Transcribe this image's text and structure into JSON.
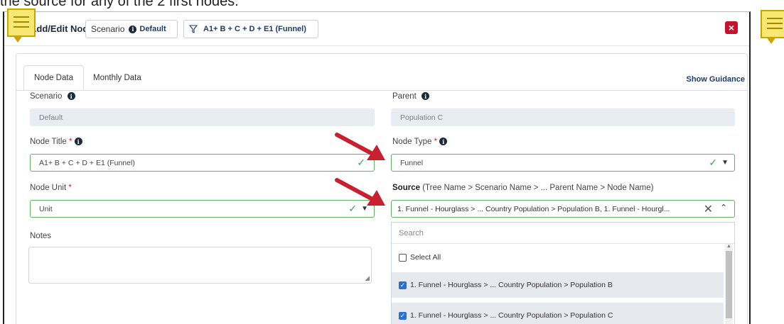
{
  "header": {
    "title": "Add/Edit Node",
    "scenario_label": "Scenario",
    "scenario_value": "Default",
    "node_label": "A1+ B + C + D + E1 (Funnel)"
  },
  "tabs": [
    {
      "label": "Node Data",
      "active": true
    },
    {
      "label": "Monthly Data",
      "active": false
    }
  ],
  "show_guidance": "Show Guidance",
  "form": {
    "scenario": {
      "label": "Scenario",
      "value": "Default"
    },
    "parent": {
      "label": "Parent",
      "value": "Population C"
    },
    "node_title": {
      "label": "Node Title",
      "value": "A1+ B + C + D + E1 (Funnel)"
    },
    "node_type": {
      "label": "Node Type",
      "value": "Funnel"
    },
    "node_unit": {
      "label": "Node Unit",
      "value": "Unit"
    },
    "source": {
      "label": "Source",
      "hint": "(Tree Name > Scenario Name > ... Parent Name > Node Name)",
      "value": "1. Funnel - Hourglass > ... Country Population > Population B, 1. Funnel - Hourgl..."
    },
    "notes": {
      "label": "Notes",
      "value": ""
    }
  },
  "required_mark": "*",
  "dropdown": {
    "search_placeholder": "Search",
    "select_all": "Select All",
    "options": [
      {
        "label": "1. Funnel - Hourglass > ... Country Population > Population B",
        "checked": true
      },
      {
        "label": "1. Funnel - Hourglass > ... Country Population > Population C",
        "checked": true
      }
    ]
  },
  "colors": {
    "accent": "#1d3a6a",
    "valid": "#5cb85c",
    "required": "#d6213a",
    "close": "#c8102e",
    "annotation_arrow": "#c8202f",
    "sticky_note": "#f7e873"
  },
  "icons": [
    "info-icon",
    "funnel-icon",
    "close-icon",
    "check-icon",
    "chevron-down-icon",
    "chevron-up-icon",
    "clear-icon",
    "sticky-note-icon"
  ],
  "top_strip_text": "the source for any of the 2 first nodes."
}
